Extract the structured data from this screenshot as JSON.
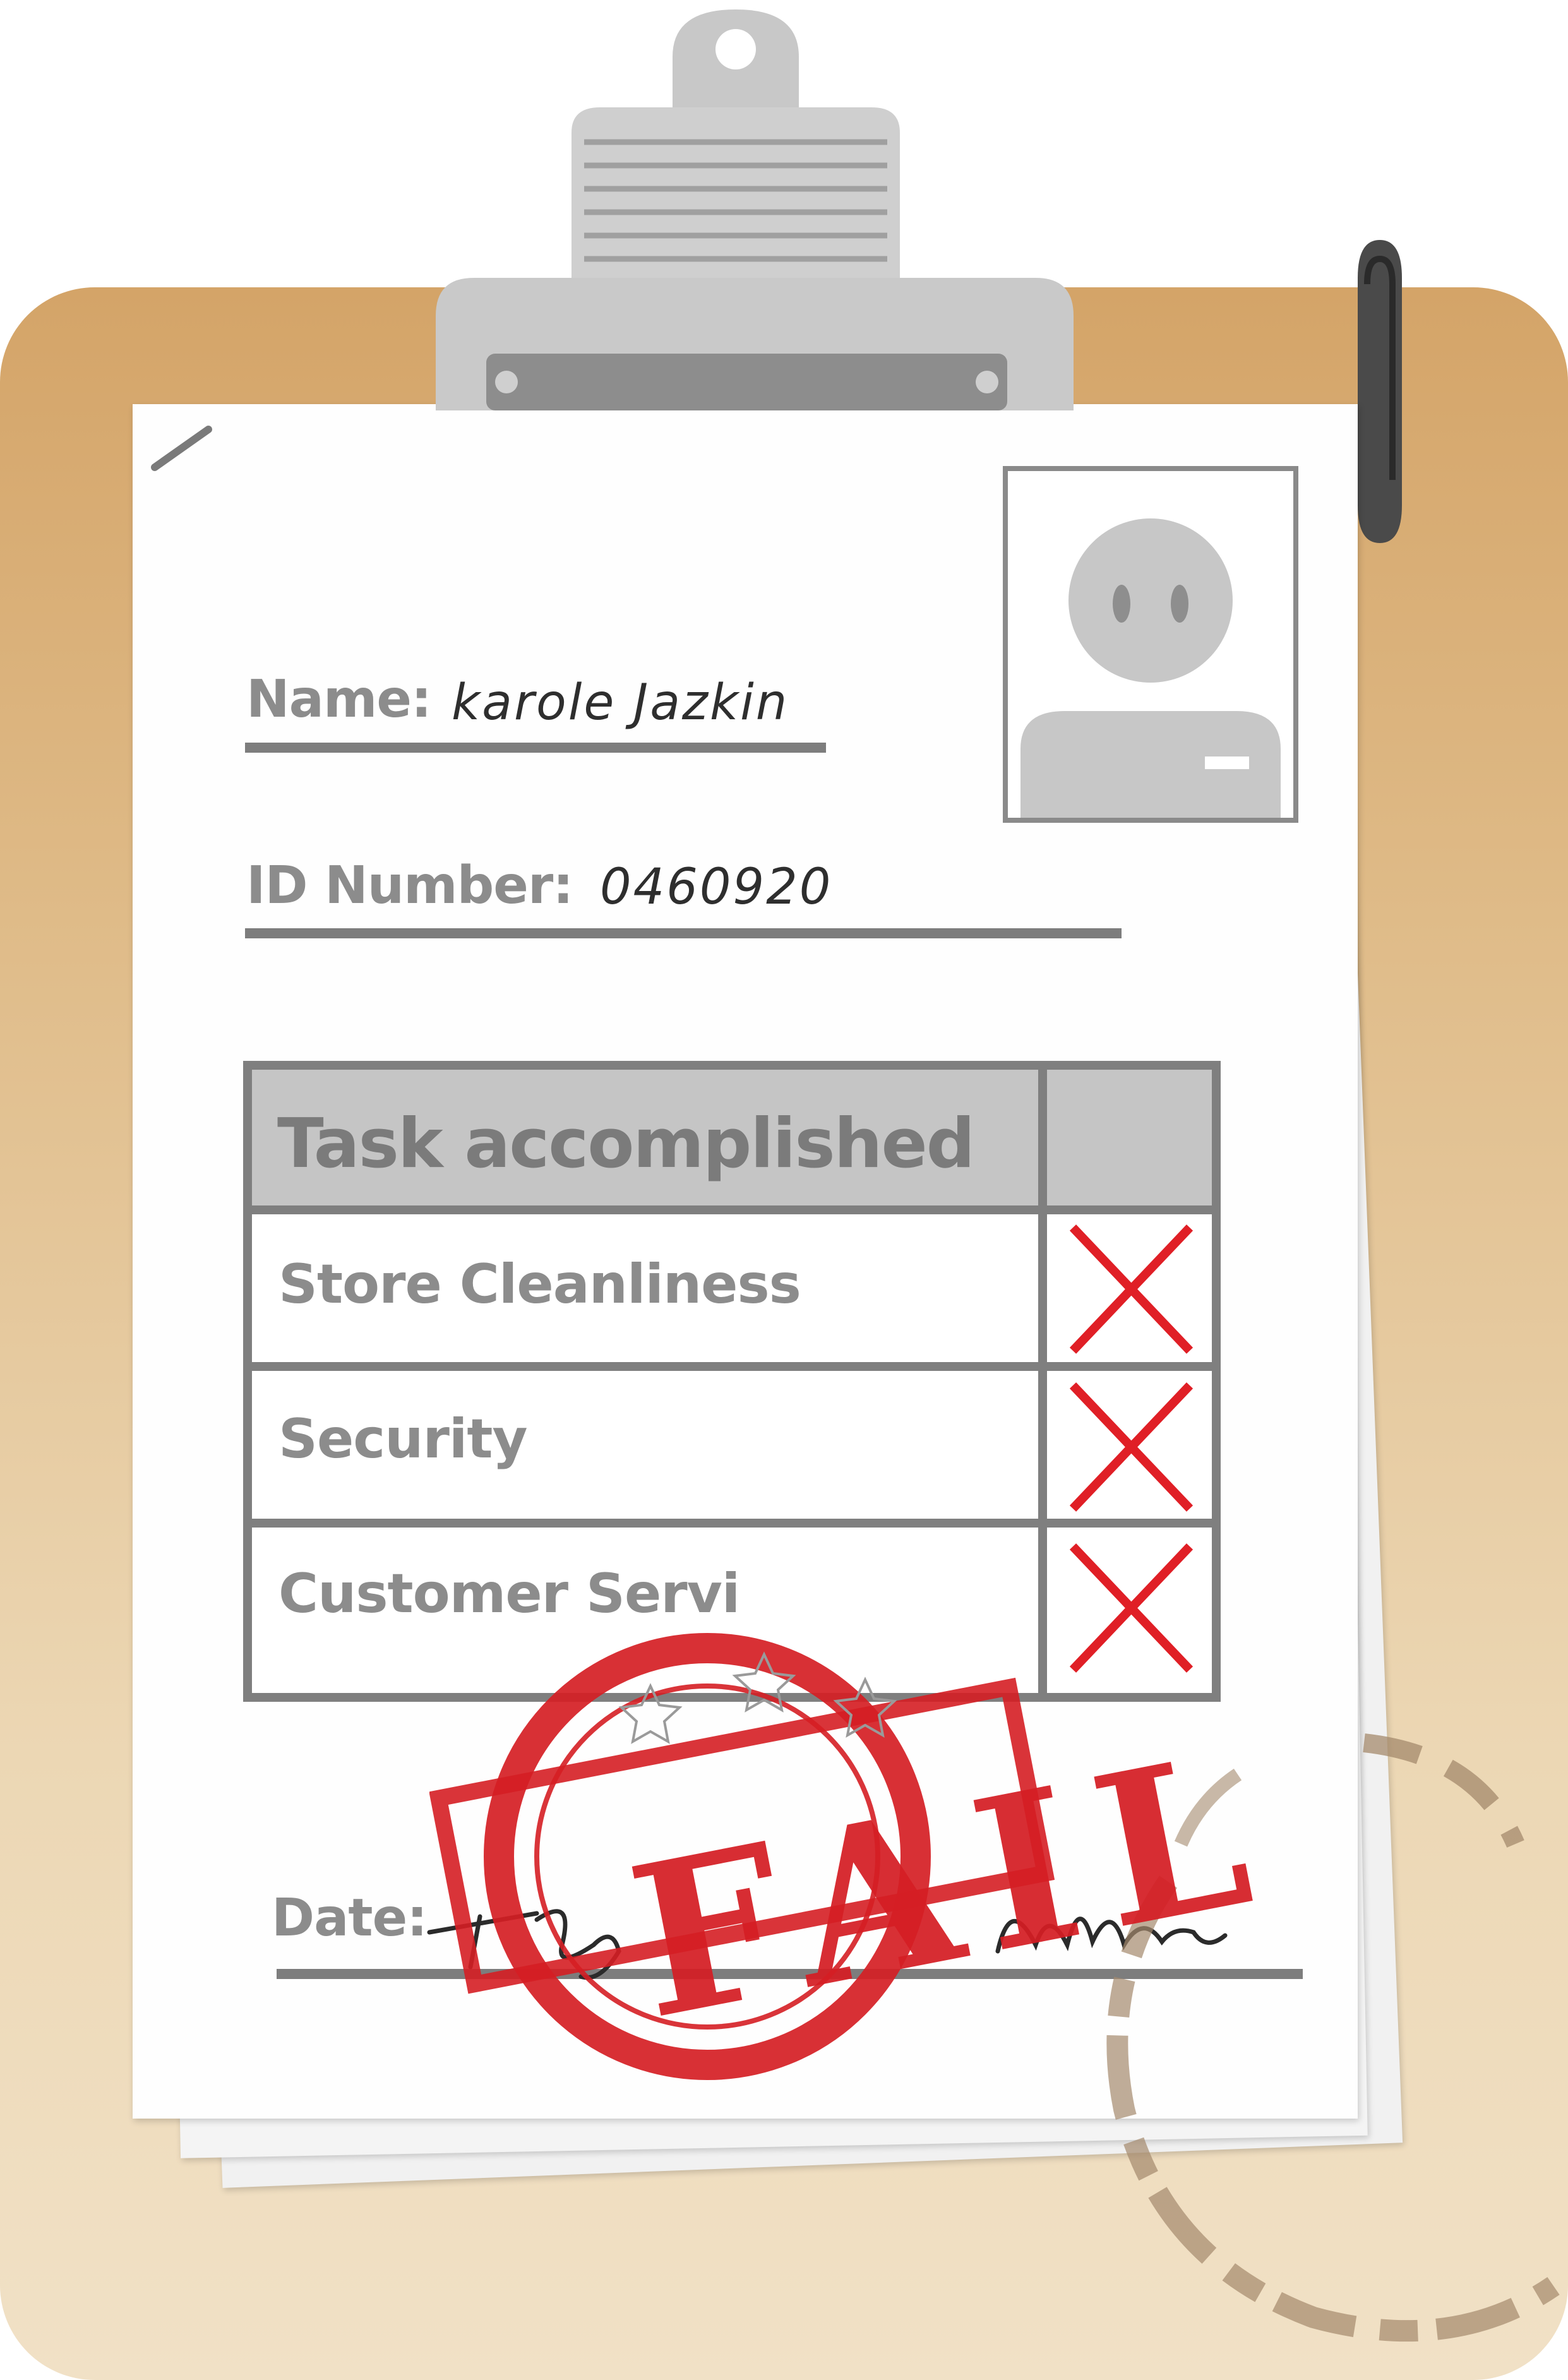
{
  "form": {
    "name_label": "Name:",
    "name_value": "karole Jazkin",
    "id_label": "ID Number:",
    "id_value": "0460920",
    "date_label": "Date:"
  },
  "table": {
    "header": "Task accomplished",
    "rows": [
      {
        "label": "Store Cleanliness",
        "status": "x"
      },
      {
        "label": "Security",
        "status": "x"
      },
      {
        "label": "Customer Servi",
        "status": "x"
      }
    ]
  },
  "stamp": {
    "text": "FAIL",
    "color": "#d51e24"
  },
  "colors": {
    "board": "#d4a468",
    "mark": "#e01f26",
    "ink_gray": "#8c8c8c"
  },
  "icons": {
    "photo": "person-silhouette-icon",
    "check": "x-mark-icon",
    "clip": "clipboard-clip-icon"
  }
}
